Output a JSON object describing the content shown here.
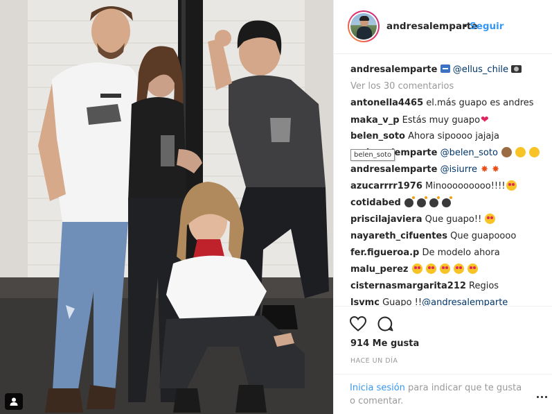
{
  "post": {
    "photo_alt": "Foto de andresalemparte",
    "tag_icon": "user-tag-icon"
  },
  "header": {
    "username": "andresalemparte",
    "separator": "•",
    "follow_label": "Seguir"
  },
  "caption": {
    "username": "andresalemparte",
    "mention": "@ellus_chile",
    "icons": [
      "soon-arrow-icon",
      "camera-flash-icon"
    ]
  },
  "view_all_label": "Ver los 30 comentarios",
  "comments": [
    {
      "user": "antonella4465",
      "text": "el.más guapo es andres"
    },
    {
      "user": "maka_v_p",
      "text": "Estás muy guapo"
    },
    {
      "user": "belen_soto",
      "text": "Ahora sipoooo jajaja"
    },
    {
      "user": "andresalemparte",
      "text": "",
      "mention": "@belen_soto"
    },
    {
      "user": "andresalemparte",
      "text": "",
      "mention": "@isiurre"
    },
    {
      "user": "azucarrrr1976",
      "text": "Minooooooooo!!!!"
    },
    {
      "user": "cotidabed",
      "text": ""
    },
    {
      "user": "priscilajaviera",
      "text": "Que guapo!!"
    },
    {
      "user": "nayareth_cifuentes",
      "text": "Que guapoooo"
    },
    {
      "user": "fer.figueroa.p",
      "text": "De modelo ahora"
    },
    {
      "user": "malu_perez",
      "text": ""
    },
    {
      "user": "cisternasmargarita212",
      "text": "Regios"
    },
    {
      "user": "lsvmc",
      "text": "Guapo !!",
      "mention": "@andresalemparte"
    }
  ],
  "tooltip": "belen_soto",
  "actions": {
    "like_icon": "heart-outline-icon",
    "comment_icon": "comment-bubble-icon",
    "likes_label": "914 Me gusta",
    "timestamp": "HACE UN DÍA"
  },
  "login": {
    "link_label": "Inicia sesión",
    "rest_text": " para indicar que te gusta o comentar."
  },
  "colors": {
    "link": "#3897f0",
    "mention": "#003569",
    "muted": "#999999",
    "text": "#262626"
  }
}
